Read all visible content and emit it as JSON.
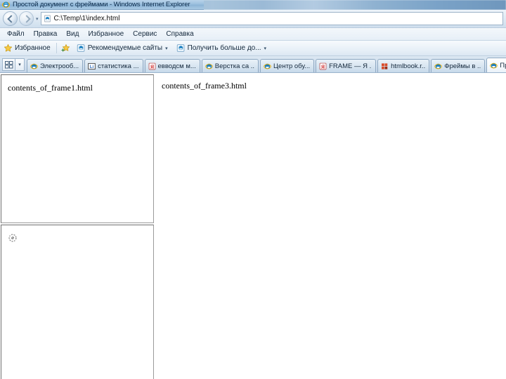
{
  "window": {
    "title": "Простой документ с фреймами - Windows Internet Explorer",
    "icon": "ie-logo-icon"
  },
  "navigation": {
    "back_label": "Назад",
    "forward_label": "Вперед",
    "recent_pages_caret": "▾",
    "address": {
      "value": "C:\\Temp\\1\\index.html",
      "placeholder": "",
      "icon": "page-icon"
    }
  },
  "menu": {
    "items": [
      {
        "label": "Файл"
      },
      {
        "label": "Правка"
      },
      {
        "label": "Вид"
      },
      {
        "label": "Избранное"
      },
      {
        "label": "Сервис"
      },
      {
        "label": "Справка"
      }
    ]
  },
  "favorites_bar": {
    "favorites_button": {
      "label": "Избранное",
      "icon": "star-icon"
    },
    "add_button": {
      "icon": "star-add-icon"
    },
    "items": [
      {
        "label": "Рекомендуемые сайты",
        "icon": "ie-feed-icon",
        "caret": "▾"
      },
      {
        "label": "Получить больше до...",
        "icon": "ie-feed-icon",
        "caret": "▾"
      }
    ]
  },
  "tab_bar": {
    "quick_tabs": {
      "icon": "quick-tabs-icon",
      "caret": "▾"
    },
    "tabs": [
      {
        "label": "Электрооб...",
        "icon": "ie-logo-icon",
        "active": false
      },
      {
        "label": "статистика ...",
        "icon": "li-icon",
        "active": false
      },
      {
        "label": "евводсм м...",
        "icon": "ya-icon",
        "active": false
      },
      {
        "label": "Верстка са ..",
        "icon": "ie-logo-icon",
        "active": false
      },
      {
        "label": "Центр обу...",
        "icon": "ie-logo-icon",
        "active": false
      },
      {
        "label": "FRAME — Я ..",
        "icon": "ya-icon",
        "active": false
      },
      {
        "label": "htmlbook.r..",
        "icon": "htmlbook-icon",
        "active": false
      },
      {
        "label": "Фреймы в ..",
        "icon": "ie-logo-icon",
        "active": false
      },
      {
        "label": "Просто...",
        "icon": "ie-logo-icon",
        "active": true,
        "close": "✕"
      }
    ]
  },
  "page": {
    "frames": [
      {
        "name": "frame1",
        "text": "contents_of_frame1.html"
      },
      {
        "name": "frame2",
        "text": "",
        "placeholder_icon": "broken-image-icon"
      },
      {
        "name": "frame3",
        "text": "contents_of_frame3.html"
      }
    ]
  },
  "colors": {
    "chrome_gradient_top": "#eef4fa",
    "chrome_gradient_bottom": "#cfdfee",
    "titlebar": "#9cc0de",
    "tab_active": "#ffffff",
    "frame_border": "#9a9a9a",
    "page_background": "#ffffff",
    "text": "#14283c"
  }
}
